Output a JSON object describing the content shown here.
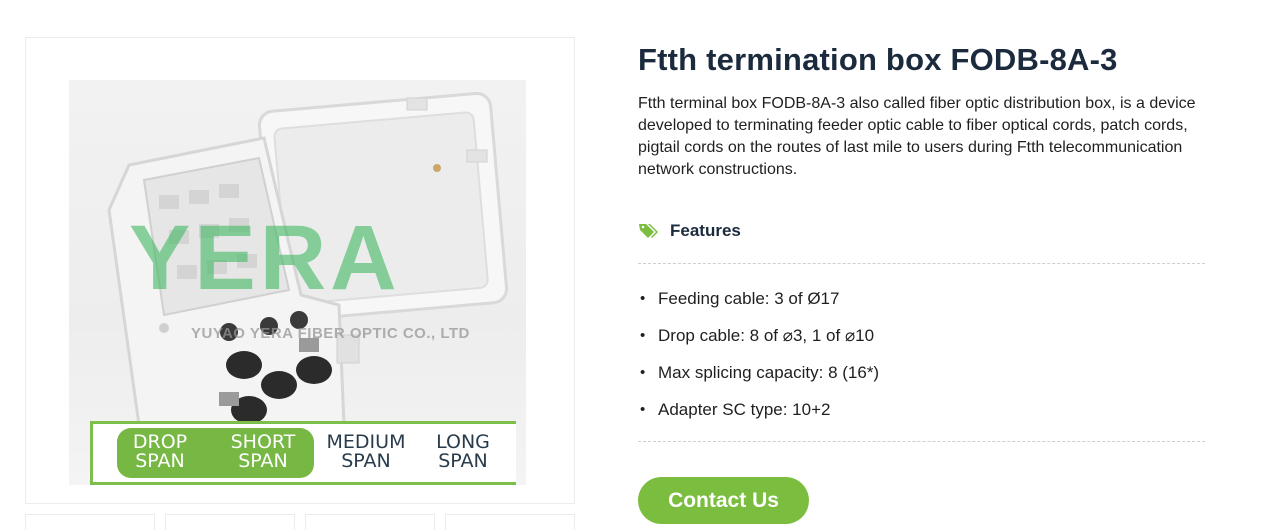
{
  "gallery": {
    "watermark": "YERA",
    "watermark_company": "YUYAO YERA FIBER OPTIC CO., LTD",
    "span_legend": [
      {
        "line1": "DROP",
        "line2": "SPAN",
        "highlighted": true
      },
      {
        "line1": "SHORT",
        "line2": "SPAN",
        "highlighted": true
      },
      {
        "line1": "MEDIUM",
        "line2": "SPAN",
        "highlighted": false
      },
      {
        "line1": "LONG",
        "line2": "SPAN",
        "highlighted": false
      }
    ],
    "highlight_color": "#76b843",
    "thumbnail_count": 4
  },
  "product": {
    "title": "Ftth termination box FODB-8A-3",
    "description": "Ftth terminal box FODB-8A-3 also called fiber optic distribution box, is a device developed to terminating feeder optic cable to fiber optical cords, patch cords, pigtail cords on the routes of last mile to users during Ftth telecommunication network constructions."
  },
  "features": {
    "icon": "tag-icon",
    "heading": "Features",
    "items": [
      "Feeding cable: 3 of Ø17",
      "Drop cable: 8 of ⌀3, 1 of ⌀10",
      "Max splicing capacity: 8 (16*)",
      "Adapter SC type: 10+2"
    ],
    "bullet": "•"
  },
  "cta": {
    "label": "Contact Us",
    "color": "#7abd3f"
  }
}
